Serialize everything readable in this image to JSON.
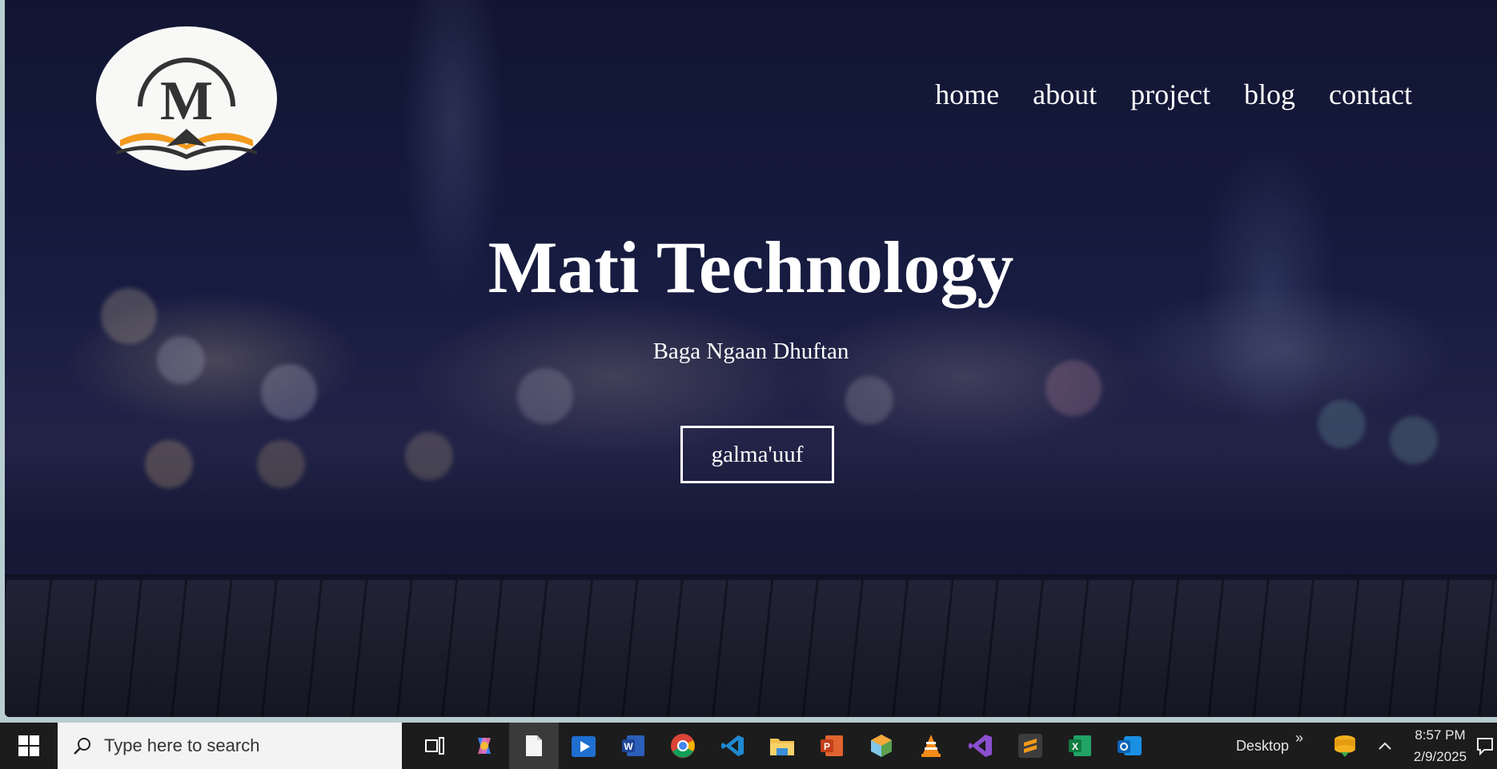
{
  "site": {
    "logo_letter": "M",
    "nav": [
      "home",
      "about",
      "project",
      "blog",
      "contact"
    ],
    "hero_title": "Mati Technology",
    "hero_subtitle": "Baga Ngaan Dhuftan",
    "cta_label": "galma'uuf"
  },
  "taskbar": {
    "search_placeholder": "Type here to search",
    "desktop_label": "Desktop",
    "chevron": "»",
    "time": "8:57 PM",
    "date": "2/9/2025",
    "apps": [
      "task-view-icon",
      "copilot-icon",
      "notepad-icon",
      "media-player-icon",
      "word-icon",
      "chrome-icon",
      "vscode-icon",
      "file-explorer-icon",
      "powerpoint-icon",
      "netbeans-icon",
      "vlc-icon",
      "visual-studio-icon",
      "sublime-text-icon",
      "excel-icon",
      "outlook-icon"
    ]
  },
  "colors": {
    "accent_orange": "#f29a1f",
    "logo_dark": "#333333"
  }
}
